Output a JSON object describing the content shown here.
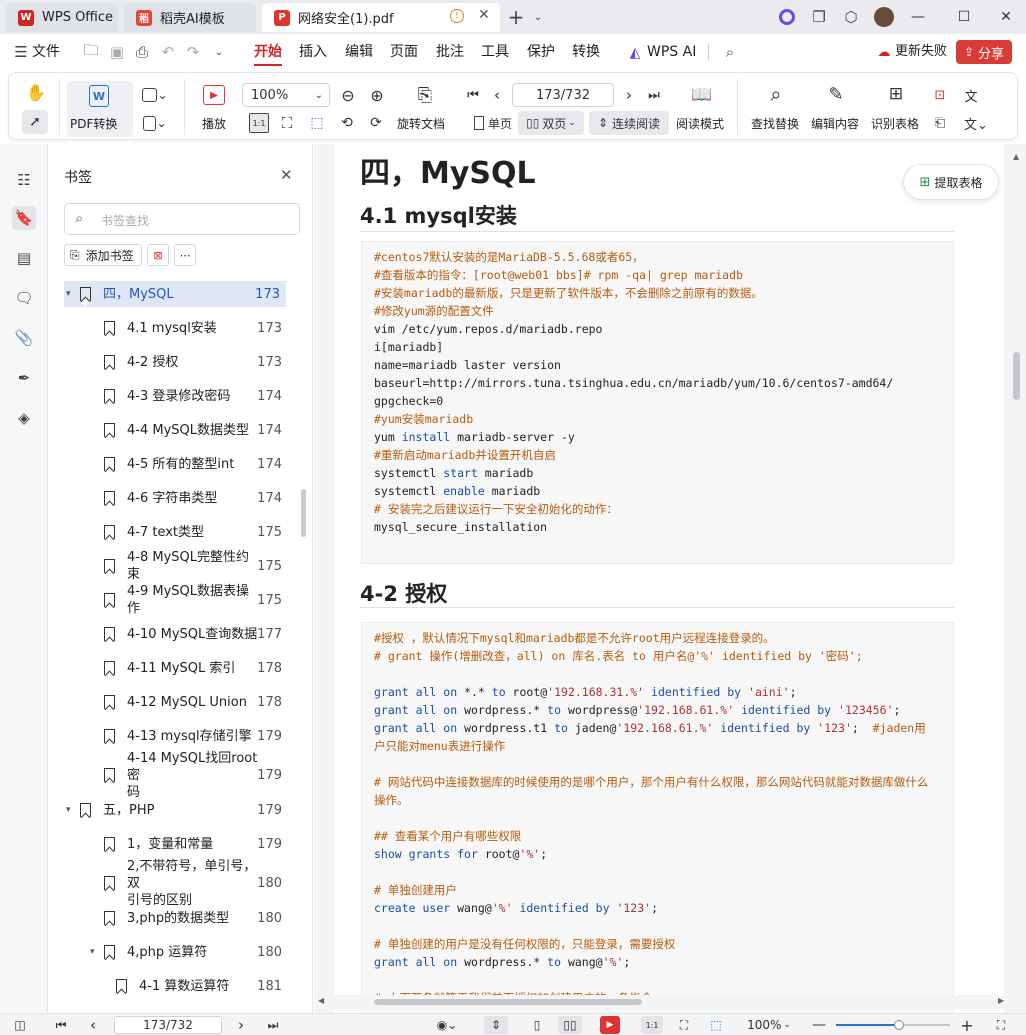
{
  "tabs": [
    {
      "label": "WPS Office",
      "icon": "wps-logo-icon"
    },
    {
      "label": "稻壳AI模板",
      "icon": "docer-logo-icon"
    },
    {
      "label": "网络安全(1).pdf",
      "icon": "pdf-logo-icon"
    }
  ],
  "menubar": {
    "file": "文件",
    "items": [
      "开始",
      "插入",
      "编辑",
      "页面",
      "批注",
      "工具",
      "保护",
      "转换"
    ],
    "wps_ai": "WPS AI",
    "update_failed": "更新失败",
    "share": "分享"
  },
  "ribbon": {
    "pdf_convert": "PDF转换",
    "play": "播放",
    "zoom": "100%",
    "page_field": "173/732",
    "rotate": "旋转文档",
    "single": "单页",
    "double": "双页",
    "continuous": "连续阅读",
    "read_mode": "阅读模式",
    "find_replace": "查找替换",
    "edit_content": "编辑内容",
    "recognize_table": "识别表格"
  },
  "panel": {
    "title": "书签",
    "search_placeholder": "书签查找",
    "add_bookmark": "添加书签",
    "items": [
      {
        "label": "四，MySQL",
        "page": "173",
        "level": 0,
        "expanded": true
      },
      {
        "label": "4.1 mysql安装",
        "page": "173",
        "level": 1
      },
      {
        "label": "4-2 授权",
        "page": "173",
        "level": 1
      },
      {
        "label": "4-3 登录修改密码",
        "page": "174",
        "level": 1
      },
      {
        "label": "4-4 MySQL数据类型",
        "page": "174",
        "level": 1
      },
      {
        "label": "4-5 所有的整型int",
        "page": "174",
        "level": 1
      },
      {
        "label": "4-6 字符串类型",
        "page": "174",
        "level": 1
      },
      {
        "label": "4-7 text类型",
        "page": "175",
        "level": 1
      },
      {
        "label": "4-8 MySQL完整性约束",
        "page": "175",
        "level": 1
      },
      {
        "label": "4-9 MySQL数据表操作",
        "page": "175",
        "level": 1
      },
      {
        "label": "4-10 MySQL查询数据",
        "page": "177",
        "level": 1
      },
      {
        "label": "4-11 MySQL 索引",
        "page": "178",
        "level": 1
      },
      {
        "label": "4-12 MySQL Union",
        "page": "178",
        "level": 1
      },
      {
        "label": "4-13 mysql存储引擎",
        "page": "179",
        "level": 1
      },
      {
        "label": "4-14 MySQL找回root密",
        "label2": "码",
        "page": "179",
        "level": 1
      },
      {
        "label": "五，PHP",
        "page": "179",
        "level": 0,
        "expanded": true
      },
      {
        "label": "1，变量和常量",
        "page": "179",
        "level": 1
      },
      {
        "label": "2,不带符号，单引号，双",
        "label2": "引号的区别",
        "page": "180",
        "level": 1
      },
      {
        "label": "3,php的数据类型",
        "page": "180",
        "level": 1
      },
      {
        "label": "4,php 运算符",
        "page": "180",
        "level": 1,
        "expanded": true
      },
      {
        "label": "4-1 算数运算符",
        "page": "181",
        "level": 2
      }
    ]
  },
  "doc": {
    "h1": "四，MySQL",
    "h2a": "4.1 mysql安装",
    "h2b": "4-2 授权",
    "extract_table": "提取表格",
    "code1": [
      "#centos7默认安装的是MariaDB-5.5.68或者65，",
      "#查看版本的指令：[root@web01 bbs]# rpm -qa| grep mariadb",
      "#安装mariadb的最新版，只是更新了软件版本，不会删除之前原有的数据。",
      "#修改yum源的配置文件",
      "vim /etc/yum.repos.d/mariadb.repo",
      "i[mariadb]",
      "name=mariadb laster version",
      "baseurl=http://mirrors.tuna.tsinghua.edu.cn/mariadb/yum/10.6/centos7-amd64/",
      "gpgcheck=0",
      "#yum安装mariadb",
      "yum install mariadb-server -y",
      "#重新启动mariadb并设置开机自启",
      "systemctl start mariadb",
      "systemctl enable mariadb",
      "# 安装完之后建议运行一下安全初始化的动作：",
      "mysql_secure_installation"
    ],
    "code2": [
      "#授权 ，默认情况下mysql和mariadb都是不允许root用户远程连接登录的。",
      "# grant 操作(增删改查，all) on 库名.表名 to 用户名@'%' identified by '密码';",
      "",
      "grant all on *.* to root@'192.168.31.%' identified by 'aini';",
      "grant all on wordpress.* to wordpress@'192.168.61.%' identified by '123456';",
      "grant all on wordpress.t1 to jaden@'192.168.61.%' identified by '123';  #jaden用",
      "户只能对menu表进行操作",
      "",
      "# 网站代码中连接数据库的时候使用的是哪个用户，那个用户有什么权限，那么网站代码就能对数据库做什么",
      "操作。",
      "",
      "## 查看某个用户有哪些权限",
      "show grants for root@'%';",
      "",
      "# 单独创建用户",
      "create user wang@'%' identified by '123';",
      "",
      "# 单独创建的用户是没有任何权限的，只能登录，需要授权",
      "grant all on wordpress.* to wang@'%';",
      "",
      "# 上面两条就等于我们前面授权加创建用户的一条指令"
    ]
  },
  "status": {
    "page_field": "173/732",
    "zoom": "100%"
  },
  "colors": {
    "accent": "#d32424",
    "code_comment": "#b55c0c",
    "code_keyword": "#1b4ea5"
  }
}
